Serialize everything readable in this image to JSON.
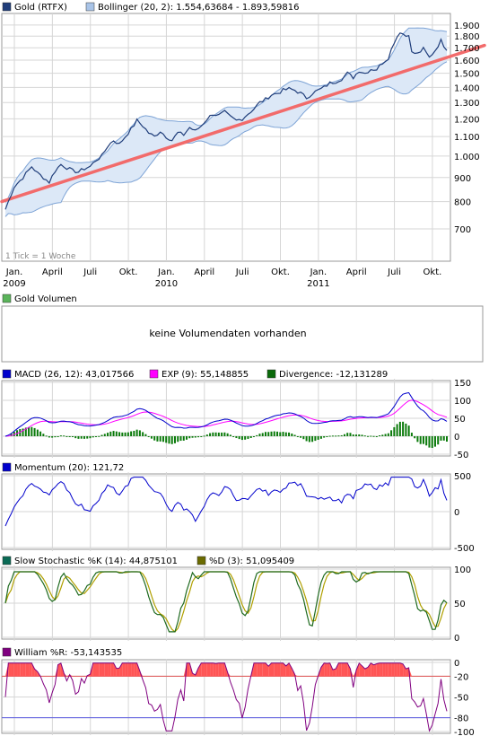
{
  "legends": {
    "price": [
      {
        "label": "Gold (RTFX)",
        "color": "#1f3d7a"
      },
      {
        "label": "Bollinger (20, 2): 1.554,63684 - 1.893,59816",
        "color": "#a9c4e8"
      }
    ],
    "volume": [
      {
        "label": "Gold Volumen",
        "color": "#5ab45a"
      }
    ],
    "macd": [
      {
        "label": "MACD (26, 12): 43,017566",
        "color": "#0000cc"
      },
      {
        "label": "EXP (9): 55,148855",
        "color": "#ff00ff"
      },
      {
        "label": "Divergence: -12,131289",
        "color": "#0a6a0a"
      }
    ],
    "momentum": [
      {
        "label": "Momentum (20): 121,72",
        "color": "#0000cc"
      }
    ],
    "stoch": [
      {
        "label": "Slow Stochastic %K (14): 44,875101",
        "color": "#0a6a55"
      },
      {
        "label": "%D (3): 51,095409",
        "color": "#6b6b00"
      }
    ],
    "william": [
      {
        "label": "William %R: -53,143535",
        "color": "#800080"
      }
    ]
  },
  "volume_message": "keine Volumendaten vorhanden",
  "tick_note": "1 Tick = 1 Woche",
  "colors": {
    "price_line": "#1f3d7a",
    "bollinger_fill": "#dce8f7",
    "bollinger_line": "#7ea4d6",
    "trend_line": "#f26b6b",
    "macd_line": "#0000cc",
    "exp_line": "#ff00ff",
    "divergence": "#0a7a0a",
    "momentum_line": "#0000cc",
    "stoch_k": "#1f6a1f",
    "stoch_d": "#b0a000",
    "william_line": "#800080",
    "william_fill": "#ff5555",
    "grid": "#d6d6d6"
  },
  "chart_data": [
    {
      "type": "line",
      "name": "price",
      "x_start": "2009-01",
      "ylim": [
        600,
        1950
      ],
      "y_ticks": [
        "1.900",
        "1.800",
        "1.700",
        "1.600",
        "1.500",
        "1.400",
        "1.300",
        "1.200",
        "1.100",
        "1.000",
        "900",
        "800",
        "700"
      ],
      "y_tick_values": [
        1900,
        1800,
        1700,
        1600,
        1500,
        1400,
        1300,
        1200,
        1100,
        1000,
        900,
        800,
        700
      ],
      "log_scale": true,
      "x_tick_labels": [
        {
          "label": "Jan.",
          "year": "2009",
          "week": 0
        },
        {
          "label": "April",
          "year": "",
          "week": 13
        },
        {
          "label": "Juli",
          "year": "",
          "week": 26
        },
        {
          "label": "Okt.",
          "year": "",
          "week": 39
        },
        {
          "label": "Jan.",
          "year": "2010",
          "week": 52
        },
        {
          "label": "April",
          "year": "",
          "week": 65
        },
        {
          "label": "Juli",
          "year": "",
          "week": 78
        },
        {
          "label": "Okt.",
          "year": "",
          "week": 91
        },
        {
          "label": "Jan.",
          "year": "2011",
          "week": 104
        },
        {
          "label": "April",
          "year": "",
          "week": 117
        },
        {
          "label": "Juli",
          "year": "",
          "week": 130
        },
        {
          "label": "Okt.",
          "year": "",
          "week": 143
        }
      ],
      "weeks": 152,
      "close_anchors": [
        [
          0,
          770
        ],
        [
          3,
          860
        ],
        [
          6,
          900
        ],
        [
          9,
          950
        ],
        [
          11,
          920
        ],
        [
          13,
          900
        ],
        [
          15,
          880
        ],
        [
          17,
          930
        ],
        [
          19,
          960
        ],
        [
          21,
          945
        ],
        [
          23,
          930
        ],
        [
          25,
          925
        ],
        [
          27,
          940
        ],
        [
          29,
          950
        ],
        [
          31,
          980
        ],
        [
          33,
          1000
        ],
        [
          35,
          1050
        ],
        [
          37,
          1080
        ],
        [
          39,
          1060
        ],
        [
          41,
          1100
        ],
        [
          43,
          1140
        ],
        [
          45,
          1190
        ],
        [
          47,
          1160
        ],
        [
          49,
          1120
        ],
        [
          51,
          1100
        ],
        [
          53,
          1130
        ],
        [
          55,
          1100
        ],
        [
          57,
          1080
        ],
        [
          59,
          1120
        ],
        [
          61,
          1110
        ],
        [
          63,
          1150
        ],
        [
          65,
          1130
        ],
        [
          67,
          1160
        ],
        [
          69,
          1200
        ],
        [
          71,
          1230
        ],
        [
          73,
          1220
        ],
        [
          75,
          1240
        ],
        [
          77,
          1210
        ],
        [
          79,
          1190
        ],
        [
          81,
          1200
        ],
        [
          83,
          1230
        ],
        [
          85,
          1260
        ],
        [
          87,
          1300
        ],
        [
          89,
          1320
        ],
        [
          91,
          1350
        ],
        [
          93,
          1360
        ],
        [
          95,
          1380
        ],
        [
          97,
          1390
        ],
        [
          99,
          1380
        ],
        [
          101,
          1360
        ],
        [
          103,
          1330
        ],
        [
          105,
          1360
        ],
        [
          107,
          1380
        ],
        [
          109,
          1400
        ],
        [
          111,
          1430
        ],
        [
          113,
          1440
        ],
        [
          115,
          1460
        ],
        [
          117,
          1500
        ],
        [
          119,
          1470
        ],
        [
          121,
          1520
        ],
        [
          123,
          1500
        ],
        [
          125,
          1530
        ],
        [
          127,
          1530
        ],
        [
          129,
          1580
        ],
        [
          131,
          1620
        ],
        [
          133,
          1750
        ],
        [
          135,
          1840
        ],
        [
          137,
          1800
        ],
        [
          138,
          1820
        ],
        [
          139,
          1660
        ],
        [
          141,
          1650
        ],
        [
          143,
          1690
        ],
        [
          145,
          1620
        ],
        [
          147,
          1680
        ],
        [
          149,
          1760
        ],
        [
          150,
          1720
        ],
        [
          151,
          1690
        ]
      ],
      "trend": {
        "start": 800,
        "end": 1720
      }
    },
    {
      "type": "line",
      "name": "macd",
      "ylim": [
        -50,
        150
      ],
      "y_ticks": [
        "150",
        "100",
        "50",
        "0",
        "-50"
      ],
      "y_tick_values": [
        150,
        100,
        50,
        0,
        -50
      ]
    },
    {
      "type": "line",
      "name": "momentum",
      "ylim": [
        -500,
        500
      ],
      "y_ticks": [
        "500",
        "0",
        "-500"
      ],
      "y_tick_values": [
        500,
        0,
        -500
      ]
    },
    {
      "type": "line",
      "name": "stochastic",
      "ylim": [
        0,
        100
      ],
      "y_ticks": [
        "100",
        "50",
        "0"
      ],
      "y_tick_values": [
        100,
        50,
        0
      ]
    },
    {
      "type": "line",
      "name": "william",
      "ylim": [
        -100,
        0
      ],
      "y_ticks": [
        "0",
        "-20",
        "-50",
        "-80",
        "-100"
      ],
      "y_tick_values": [
        0,
        -20,
        -50,
        -80,
        -100
      ],
      "ref_lines": [
        -20,
        -80
      ]
    }
  ]
}
